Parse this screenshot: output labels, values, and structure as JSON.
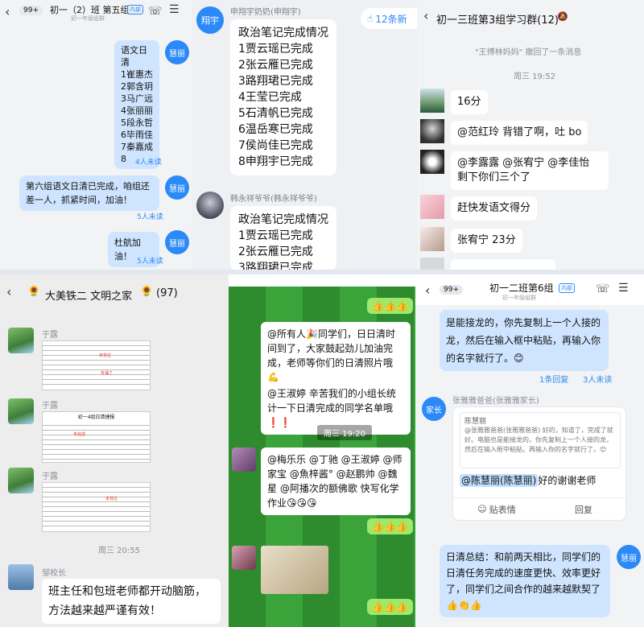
{
  "p1": {
    "badge": "99+",
    "title": "初一（2）班 第五组",
    "subtitle": "初一年级组群",
    "tag": "内部",
    "msg1_lines": [
      "语文日清",
      "1崔惠杰",
      "2郭含玥",
      "3马广远",
      "4张丽丽",
      "5段永哲",
      "6毕雨佳",
      "7秦嘉成",
      "8"
    ],
    "msg1_status": "4人未读",
    "msg2": "第六组语文日清已完成，咱组还差一人，抓紧时间，加油！",
    "msg2_status": "5人未读",
    "msg3": "杜航加油！",
    "msg3_status": "5人未读",
    "avatar": "慧丽"
  },
  "p2": {
    "avatar1": "翔宇",
    "sender1": "申翔宇奶奶(申翔宇)",
    "msg1_lines": [
      "政治笔记完成情况",
      "1贾云瑶已完成",
      "2张云雁已完成",
      "3路翔珺已完成",
      "4王莹已完成",
      "5石清帆已完成",
      "6温岳寒已完成",
      "7侯尚佳已完成",
      "8申翔宇已完成"
    ],
    "new_badge": "12条新",
    "sender2": "韩永祥爷爷(韩永祥爷爷)",
    "msg2_lines": [
      "政治笔记完成情况",
      "1贾云瑶已完成",
      "2张云雁已完成",
      "3路翔珺已完成"
    ]
  },
  "p3": {
    "title": "初一三班第3组学习群(12)",
    "recall": "\"王博林妈妈\" 撤回了一条消息",
    "time": "周三 19:52",
    "msgs": [
      "16分",
      "@范红玲  背错了啊，吐 bo",
      "@李露露  @张宥宁  @李佳怡  剩下你们三个了",
      "赶快发语文得分",
      "张宥宁 23分"
    ]
  },
  "p4": {
    "title": "大美铁二 文明之家",
    "count": "(97)",
    "sender": "于露",
    "img2_title": "初一4组日清捷报",
    "time": "周三 20:55",
    "sender2": "邹校长",
    "msg": "班主任和包班老师都开动脑筋，方法越来越严谨有效！",
    "table_labels": [
      "姓名",
      "语文",
      "数学",
      "英语",
      "政治",
      "历史",
      "地理",
      "生物"
    ],
    "red1": "未背过",
    "red2": "背诵了",
    "red3": "未完成"
  },
  "p5": {
    "msg1": "@所有人🎉同学们，日日清时间到了，大家鼓起劲儿加油完成，老师等你们的日清照片哦💪",
    "msg2": "@王淑婷  辛苦我们的小组长统计一下日清完成的同学名单哦❗❗",
    "time": "周三 19:20",
    "msg3": "@梅乐乐 @丁驰 @王淑婷 @师家宝 @魚梓酱° @赵鹏帅 @魏星 @阿播次的额佛歌 快写化学作业😘😘😘",
    "thumbs": "👍👍👍"
  },
  "p6": {
    "badge": "99+",
    "title": "初一二班第6组",
    "tag": "内部",
    "subtitle": "初一年级组群",
    "top_msg": "是能接龙的，你先复制上一个人接的龙，然后在输入框中粘贴，再输入你的名字就行了。😊",
    "reply": "1条回复",
    "unread": "3人未读",
    "sender": "张雅雅爸爸(张雅雅家长)",
    "avatar_parent": "家长",
    "quote_name": "陈慧丽",
    "quote": "@张雅雅爸爸(张雅雅爸爸) 好的，知道了，完成了就好。电脑也是能接龙的，你先复制上一个人接的龙，然后在输入框中粘贴，再输入你的名字就行了。😊",
    "mention": "@陈慧丽(陈慧丽)",
    "reply_text": "好的谢谢老师",
    "sticker": "贴表情",
    "reply_btn": "回复",
    "summary": "日清总结：和前两天相比，同学们的日清任务完成的速度更快、效率更好了，同学们之间合作的越来越默契了 👍👏👍",
    "avatar": "慧丽"
  }
}
